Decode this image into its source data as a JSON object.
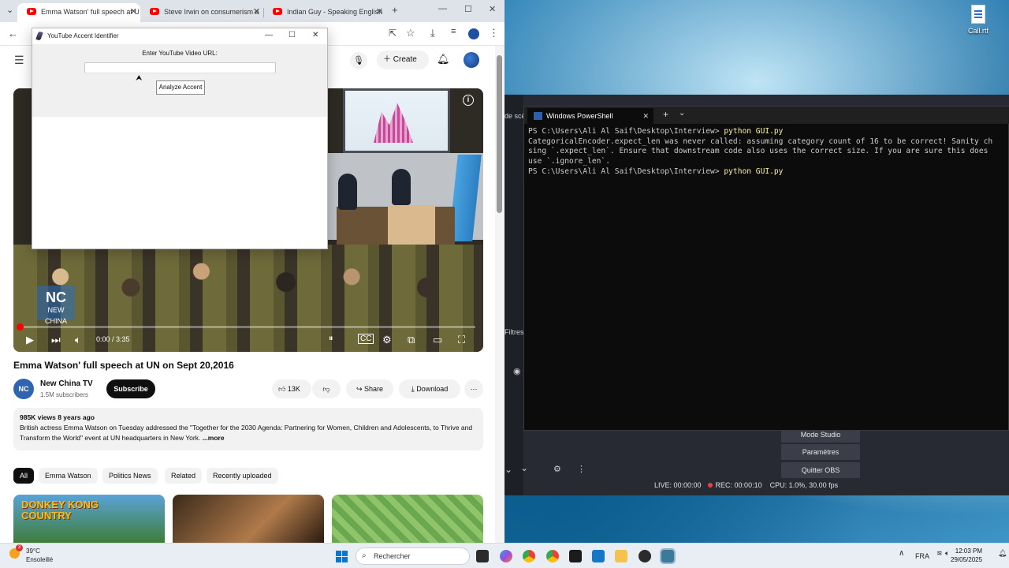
{
  "browser": {
    "tabs": [
      {
        "label": "Emma Watson' full speech at U",
        "active": true
      },
      {
        "label": "Steve Irwin on consumerism a",
        "active": false
      },
      {
        "label": "Indian Guy - Speaking English",
        "active": false
      }
    ],
    "new_tab": "+",
    "header": {
      "create_label": "Create"
    }
  },
  "dialog": {
    "title": "YouTube Accent Identifier",
    "prompt": "Enter YouTube Video URL:",
    "url_value": "",
    "button": "Analyze Accent"
  },
  "video": {
    "time": "0:00 / 3:35",
    "logo_text": "NEW CHINA",
    "title": "Emma Watson' full speech at UN on Sept 20,2016",
    "progress_percent": 0
  },
  "channel": {
    "avatar": "NC",
    "name": "New China TV",
    "subs": "1.5M subscribers",
    "subscribe": "Subscribe"
  },
  "actions": {
    "likes": "13K",
    "share": "Share",
    "download": "Download"
  },
  "description": {
    "meta": "985K views  8 years ago",
    "text": "British actress Emma Watson on Tuesday addressed the \"Together for the 2030 Agenda: Partnering for Women, Children and Adolescents, to Thrive and Transform the World\" event at UN headquarters in New York.",
    "more": " ...more"
  },
  "chips": [
    "All",
    "Emma Watson",
    "Politics News",
    "Related",
    "Recently uploaded"
  ],
  "thumbs": [
    {
      "label": "DONKEY KONG COUNTRY"
    }
  ],
  "desktop": {
    "icon_label": "Call.rtf"
  },
  "obs": {
    "side_labels": [
      "de scè",
      "Filtres"
    ],
    "buttons": [
      "Mode Studio",
      "Paramètres",
      "Quitter OBS"
    ],
    "live": "LIVE: 00:00:00",
    "rec": "REC: 00:00:10",
    "cpu": "CPU: 1.0%, 30.00 fps"
  },
  "powershell": {
    "tab_title": "Windows PowerShell",
    "lines": [
      {
        "prompt": "PS C:\\Users\\Ali Al Saif\\Desktop\\Interview> ",
        "cmd": "python GUI.py"
      },
      {
        "text": "CategoricalEncoder.expect_len was never called: assuming category count of 16 to be correct! Sanity ch"
      },
      {
        "text": "sing `.expect_len`. Ensure that downstream code also uses the correct size. If you are sure this does"
      },
      {
        "text": "use `.ignore_len`."
      },
      {
        "prompt": "PS C:\\Users\\Ali Al Saif\\Desktop\\Interview> ",
        "cmd": "python GUI.py"
      }
    ]
  },
  "taskbar": {
    "weather_temp": "39°C",
    "weather_desc": "Ensoleillé",
    "weather_badge": "3",
    "search": "Rechercher",
    "lang": "FRA",
    "time": "12:03 PM",
    "date": "29/05/2025"
  }
}
